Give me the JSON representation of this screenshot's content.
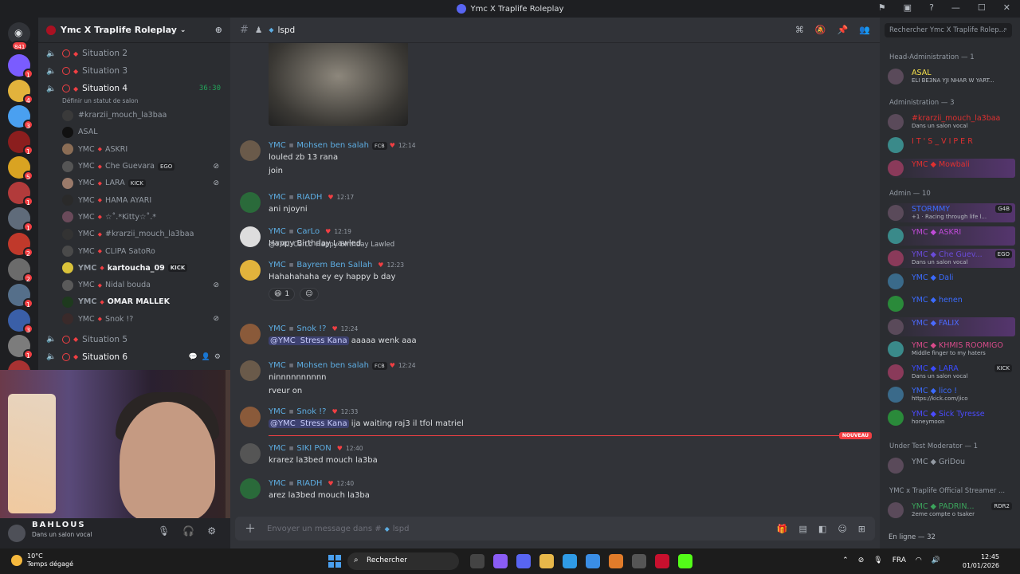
{
  "window": {
    "title": "Ymc X Traplife Roleplay"
  },
  "servers": {
    "home_badge": "841",
    "badges": [
      "1",
      "4",
      "3",
      "1",
      "5",
      "1",
      "1",
      "2",
      "2",
      "1",
      "3",
      "1",
      "2"
    ]
  },
  "channels": {
    "server_name": "Ymc X Traplife Roleplay",
    "voice": [
      {
        "name": "Situation 2"
      },
      {
        "name": "Situation 3"
      },
      {
        "name": "Situation 4",
        "timer": "36:30",
        "status": "Définir un statut de salon"
      }
    ],
    "members": [
      {
        "prefix": "",
        "name": "#krarzii_mouch_la3baa",
        "pill": "",
        "muted": false
      },
      {
        "prefix": "",
        "name": "ASAL",
        "pill": "",
        "muted": false
      },
      {
        "prefix": "YMC",
        "name": "ASKRI",
        "pill": "",
        "muted": false
      },
      {
        "prefix": "YMC",
        "name": "Che Guevara",
        "pill": "EGO",
        "muted": true
      },
      {
        "prefix": "YMC",
        "name": "LARA",
        "pill": "KICK",
        "muted": true
      },
      {
        "prefix": "YMC",
        "name": "HAMA AYARI",
        "pill": "",
        "muted": false
      },
      {
        "prefix": "YMC",
        "name": "☆˚.*Kitty☆˚.*",
        "pill": "",
        "muted": false
      },
      {
        "prefix": "YMC",
        "name": "#krarzii_mouch_la3baa",
        "pill": "",
        "muted": false
      },
      {
        "prefix": "YMC",
        "name": "CLIPA SatoRo",
        "pill": "",
        "muted": false
      },
      {
        "prefix": "YMC",
        "name": "kartoucha_09",
        "pill": "KICK",
        "muted": false,
        "bright": true
      },
      {
        "prefix": "YMC",
        "name": "Nidal bouda",
        "pill": "",
        "muted": true
      },
      {
        "prefix": "YMC",
        "name": "OMAR MALLEK",
        "pill": "",
        "muted": false,
        "bright": true
      },
      {
        "prefix": "YMC",
        "name": "Snok !?",
        "pill": "",
        "muted": true
      }
    ],
    "voice_after": [
      {
        "name": "Situation 5"
      },
      {
        "name": "Situation 6"
      }
    ]
  },
  "user_panel": {
    "name": "BAHLOUS",
    "status": "Dans un salon vocal"
  },
  "chat": {
    "channel_name": "lspd",
    "messages": [
      {
        "prefix": "YMC",
        "name": "Mohsen ben salah",
        "tag": "FCB",
        "time": "12:14",
        "lines": [
          "louled zb 13 rana",
          "join"
        ]
      },
      {
        "prefix": "YMC",
        "name": "RIADH",
        "tag": "",
        "time": "12:17",
        "lines": [
          "ani njoyni"
        ]
      },
      {
        "prefix": "YMC",
        "name": "CarLo",
        "tag": "",
        "time": "12:19",
        "lines": [
          "Happy Birthday Lawled"
        ]
      },
      {
        "prefix": "YMC",
        "name": "Bayrem Ben Sallah",
        "tag": "",
        "time": "12:23",
        "reply": {
          "prefix": "@YMC",
          "name": "CarLo",
          "text": "Happy Birthday Lawled"
        },
        "lines": [
          "Hahahahaha ey ey happy b day"
        ],
        "reaction_count": "1"
      },
      {
        "prefix": "YMC",
        "name": "Snok !?",
        "tag": "",
        "time": "12:24",
        "mention": "@YMC",
        "mention_name": "Stress Kana",
        "lines": [
          "aaaaa wenk aaa"
        ]
      },
      {
        "prefix": "YMC",
        "name": "Mohsen ben salah",
        "tag": "FCB",
        "time": "12:24",
        "lines": [
          "ninnnnnnnnnn",
          "rveur on"
        ]
      },
      {
        "prefix": "YMC",
        "name": "Snok !?",
        "tag": "",
        "time": "12:33",
        "mention": "@YMC",
        "mention_name": "Stress Kana",
        "lines": [
          "ija waiting raj3 il tfol matriel"
        ]
      },
      {
        "prefix": "YMC",
        "name": "SIKI PON",
        "tag": "",
        "time": "12:40",
        "lines": [
          "krarez la3bed mouch la3ba"
        ]
      },
      {
        "prefix": "YMC",
        "name": "RIADH",
        "tag": "",
        "time": "12:40",
        "lines": [
          "arez la3bed mouch la3ba"
        ]
      }
    ],
    "new_label": "NOUVEAU",
    "composer_placeholder": "Envoyer un message dans #",
    "composer_channel": "lspd"
  },
  "members_list": {
    "search_placeholder": "Rechercher Ymc X Traplife Rolep...",
    "groups": [
      {
        "label": "Head-Administration — 1"
      },
      {
        "label": "Administration — 3"
      },
      {
        "label": "Admin — 10"
      },
      {
        "label": "Under Test Moderator — 1"
      },
      {
        "label": "YMC x Traplife Official Streamer ..."
      }
    ],
    "head_admin": [
      {
        "name": "ASAL",
        "sub": "ELI BE3NA YJI NHAR W YART..."
      }
    ],
    "administration": [
      {
        "name": "#krarzii_mouch_la3baa",
        "sub": "Dans un salon vocal"
      },
      {
        "name": "I T ' S _ V I P E R",
        "sub": ""
      },
      {
        "name": "YMC ◆ Mowbali",
        "sub": ""
      }
    ],
    "admin": [
      {
        "name": "STORMMY",
        "sub": "+1 · Racing through life l...",
        "pill": "G4B"
      },
      {
        "name": "YMC ◆ ASKRI",
        "sub": ""
      },
      {
        "name": "YMC ◆ Che Guev...",
        "sub": "Dans un salon vocal",
        "pill": "EGO"
      },
      {
        "name": "YMC ◆ Dali",
        "sub": ""
      },
      {
        "name": "YMC ◆ henen",
        "sub": ""
      },
      {
        "name": "YMC ◆ FALIX",
        "sub": ""
      },
      {
        "name": "YMC ◆ KHMIS ROOMIGO",
        "sub": "Middle finger to my haters"
      },
      {
        "name": "YMC ◆ LARA",
        "sub": "Dans un salon vocal",
        "pill": "KICK"
      },
      {
        "name": "YMC ◆ lico !",
        "sub": "https://kick.com/jico"
      },
      {
        "name": "YMC ◆ Sick Tyresse",
        "sub": "honeymoon"
      }
    ],
    "under_test": [
      {
        "name": "YMC ◆ GriDou",
        "sub": ""
      }
    ],
    "streamer": [
      {
        "name": "YMC ◆ PADRIN...",
        "sub": "2eme compte o tsaker",
        "pill": "RDR2"
      }
    ],
    "online": "En ligne — 32"
  },
  "taskbar": {
    "temp": "10°C",
    "weather": "Temps dégagé",
    "search": "Rechercher",
    "lang": "FRA",
    "time": "12:45",
    "date": "01/01/2026"
  }
}
